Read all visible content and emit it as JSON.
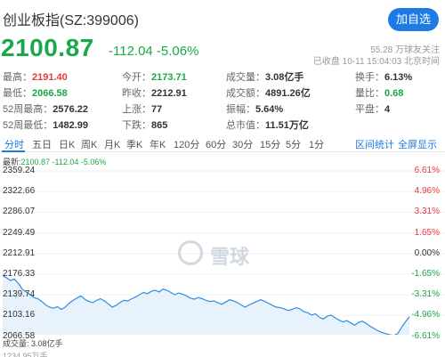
{
  "header": {
    "title": "创业板指(SZ:399006)",
    "follow_label": "加自选",
    "price": "2100.87",
    "change": "-112.04 -5.06%",
    "followers": "55.28 万球友关注",
    "status": "已收盘 10-11 15:04:03 北京时间"
  },
  "stats": [
    {
      "label": "最高：",
      "value": "2191.40",
      "color": "red"
    },
    {
      "label": "今开：",
      "value": "2173.71",
      "color": "green"
    },
    {
      "label": "成交量：",
      "value": "3.08亿手",
      "color": "plain"
    },
    {
      "label": "换手：",
      "value": "6.13%",
      "color": "plain"
    },
    {
      "label": "最低：",
      "value": "2066.58",
      "color": "green"
    },
    {
      "label": "昨收：",
      "value": "2212.91",
      "color": "plain"
    },
    {
      "label": "成交额：",
      "value": "4891.26亿",
      "color": "plain"
    },
    {
      "label": "量比：",
      "value": "0.68",
      "color": "green"
    },
    {
      "label": "52周最高：",
      "value": "2576.22",
      "color": "plain"
    },
    {
      "label": "上涨：",
      "value": "77",
      "color": "plain"
    },
    {
      "label": "振幅：",
      "value": "5.64%",
      "color": "plain"
    },
    {
      "label": "平盘：",
      "value": "4",
      "color": "plain"
    },
    {
      "label": "52周最低：",
      "value": "1482.99",
      "color": "plain"
    },
    {
      "label": "下跌：",
      "value": "865",
      "color": "plain"
    },
    {
      "label": "总市值：",
      "value": "11.51万亿",
      "color": "plain"
    }
  ],
  "tabs": [
    "分时",
    "五日",
    "日K",
    "周K",
    "月K",
    "季K",
    "年K",
    "120分",
    "60分",
    "30分",
    "15分",
    "5分",
    "1分"
  ],
  "tab_right": [
    "区间统计",
    "全屏显示"
  ],
  "legend": {
    "prefix": "最新:",
    "value": "2100.87 -112.04 -5.06%"
  },
  "watermark": "雪球",
  "volume_label": "成交量: 3.08亿手",
  "volume_cut": "1234.95万手",
  "colors": {
    "up": "#E53935",
    "down": "#19A84A",
    "accent": "#1E7BE6",
    "line": "#2E8CE6"
  },
  "chart_data": {
    "type": "line",
    "y_ticks_left": [
      "2359.24",
      "2322.66",
      "2286.07",
      "2249.49",
      "2212.91",
      "2176.33",
      "2139.74",
      "2103.16",
      "2066.58"
    ],
    "y_ticks_right": [
      "6.61%",
      "4.96%",
      "3.31%",
      "1.65%",
      "0.00%",
      "-1.65%",
      "-3.31%",
      "-4.96%",
      "-6.61%"
    ],
    "ylim": [
      2066.58,
      2359.24
    ],
    "prev_close": 2212.91,
    "series": [
      {
        "values": [
          2173.7,
          2170.0,
          2165.0,
          2168.0,
          2160.0,
          2150.0,
          2145.0,
          2140.0,
          2135.0,
          2133.0,
          2128.0,
          2122.0,
          2118.0,
          2116.0,
          2119.0,
          2114.0,
          2118.0,
          2125.0,
          2130.0,
          2134.0,
          2138.0,
          2132.0,
          2128.0,
          2126.0,
          2130.0,
          2133.0,
          2129.0,
          2124.0,
          2118.0,
          2121.0,
          2126.0,
          2130.0,
          2129.0,
          2133.0,
          2136.0,
          2140.0,
          2144.0,
          2142.0,
          2146.0,
          2148.0,
          2145.0,
          2150.0,
          2148.0,
          2144.0,
          2140.0,
          2143.0,
          2141.0,
          2138.0,
          2134.0,
          2132.0,
          2135.0,
          2133.0,
          2130.0,
          2128.0,
          2129.0,
          2126.0,
          2123.0,
          2127.0,
          2131.0,
          2129.0,
          2126.0,
          2122.0,
          2118.0,
          2122.0,
          2125.0,
          2128.0,
          2131.0,
          2128.0,
          2125.0,
          2121.0,
          2118.0,
          2117.0,
          2115.0,
          2112.0,
          2114.0,
          2117.0,
          2115.0,
          2110.0,
          2108.0,
          2104.0,
          2106.0,
          2100.0,
          2097.0,
          2102.0,
          2104.0,
          2099.0,
          2095.0,
          2092.0,
          2094.0,
          2090.0,
          2086.0,
          2091.0,
          2093.0,
          2089.0,
          2084.0,
          2080.0,
          2076.0,
          2073.0,
          2071.0,
          2069.0,
          2068.0,
          2071.0,
          2082.0,
          2092.0,
          2100.9
        ]
      }
    ]
  }
}
